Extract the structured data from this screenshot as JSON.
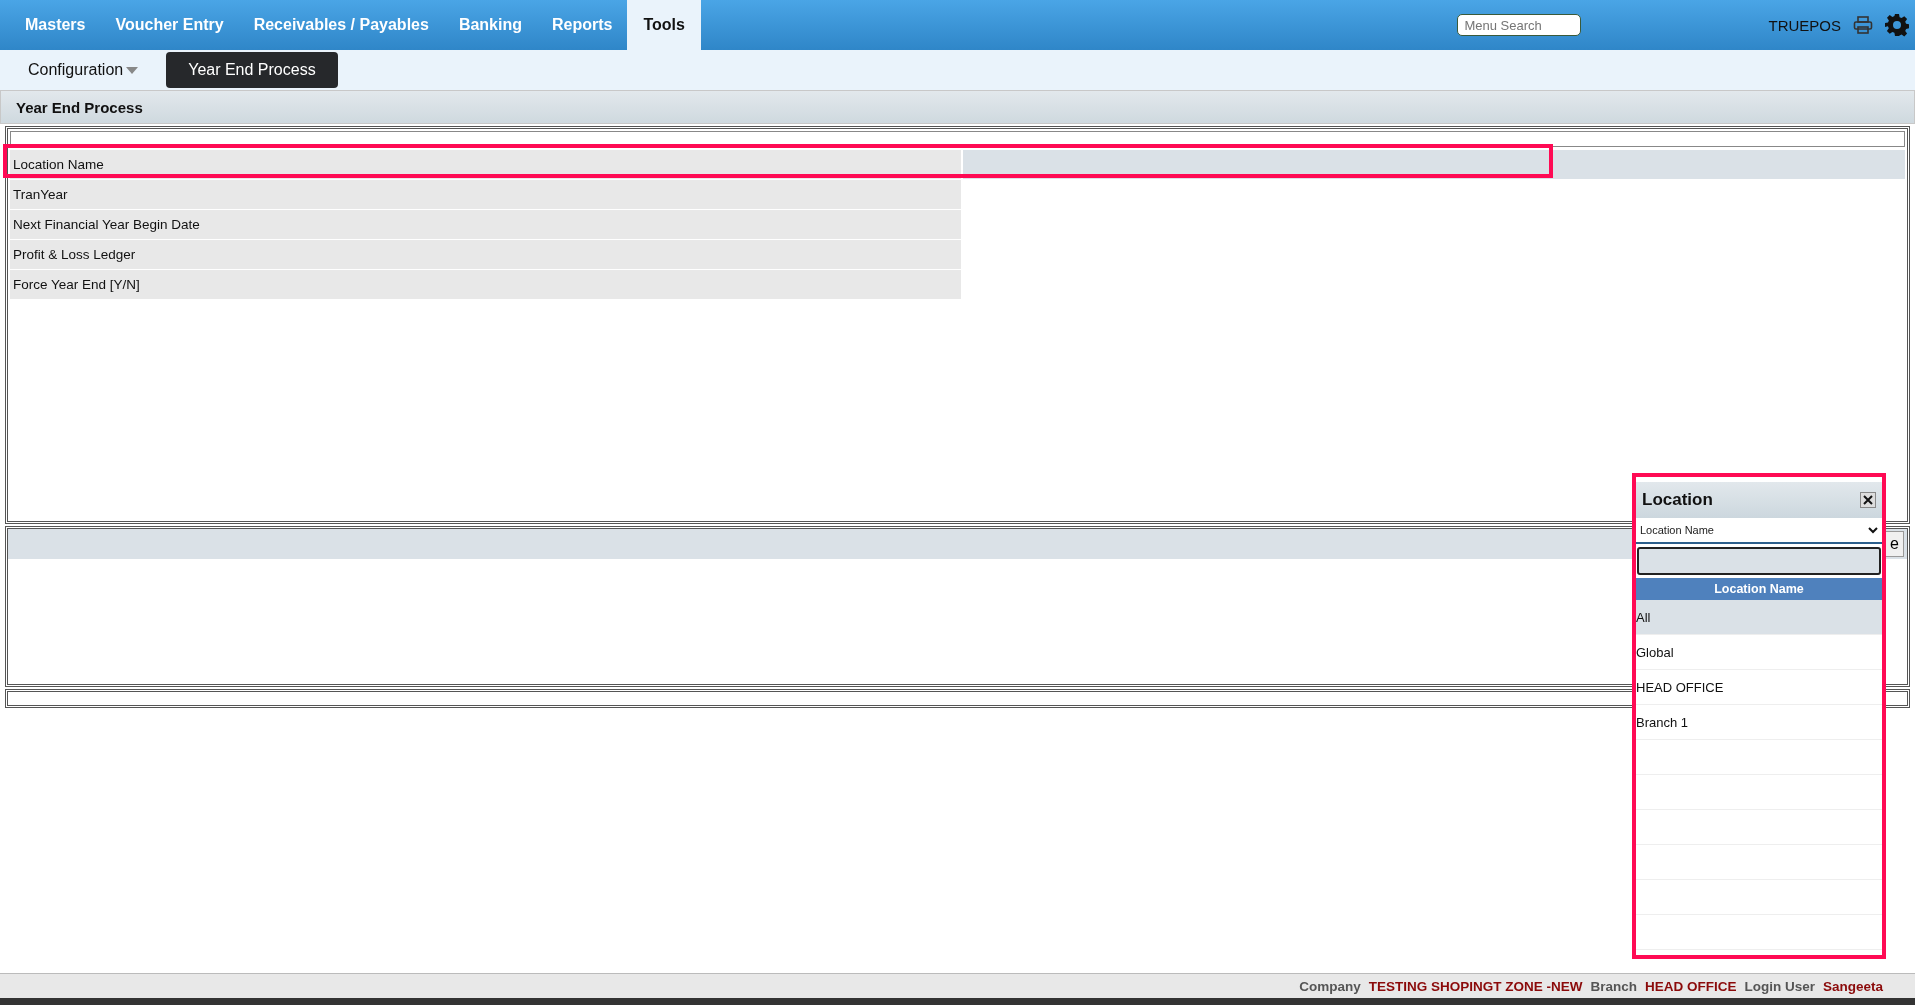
{
  "menu": [
    {
      "label": "Masters",
      "selected": false
    },
    {
      "label": "Voucher Entry",
      "selected": false
    },
    {
      "label": "Receivables / Payables",
      "selected": false
    },
    {
      "label": "Banking",
      "selected": false
    },
    {
      "label": "Reports",
      "selected": false
    },
    {
      "label": "Tools",
      "selected": true
    }
  ],
  "menu_search": {
    "placeholder": "Menu Search"
  },
  "app_name": "TRUEPOS",
  "submenu": [
    {
      "label": "Configuration",
      "kind": "dropdown",
      "selected": false
    },
    {
      "label": "Year End Process",
      "kind": "button",
      "selected": true
    }
  ],
  "panel": {
    "title": "Year End Process",
    "fields": [
      {
        "label": "Location Name",
        "focused": true
      },
      {
        "label": "TranYear",
        "focused": false
      },
      {
        "label": "Next Financial Year Begin Date",
        "focused": false
      },
      {
        "label": "Profit & Loss Ledger",
        "focused": false
      },
      {
        "label": "Force Year End [Y/N]",
        "focused": false
      }
    ],
    "action_button": {
      "label": "e"
    }
  },
  "popup": {
    "title": "Location",
    "filter_by": "Location Name",
    "column": "Location Name",
    "rows": [
      {
        "label": "All",
        "selected": true
      },
      {
        "label": "Global",
        "selected": false
      },
      {
        "label": "HEAD OFFICE",
        "selected": false
      },
      {
        "label": "Branch 1",
        "selected": false
      }
    ]
  },
  "status_bar": [
    {
      "label": "Company",
      "value": "TESTING SHOPINGT ZONE -NEW"
    },
    {
      "label": "Branch",
      "value": "HEAD OFFICE"
    },
    {
      "label": "Login User",
      "value": "Sangeeta"
    }
  ]
}
